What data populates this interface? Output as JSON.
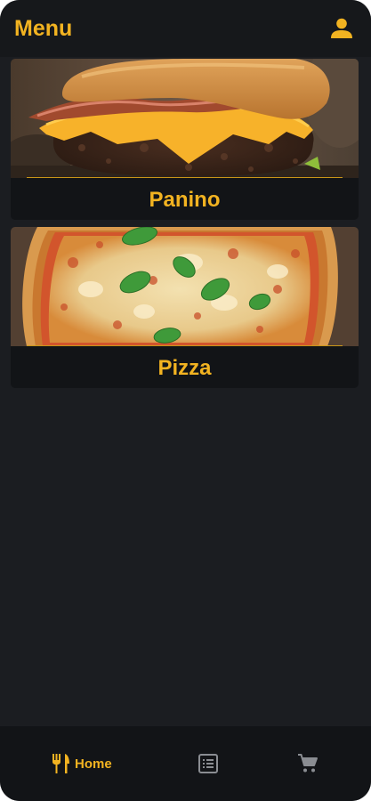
{
  "header": {
    "title": "Menu",
    "profile_icon": "person-icon"
  },
  "menu": {
    "items": [
      {
        "label": "Panino",
        "image": "burger-photo"
      },
      {
        "label": "Pizza",
        "image": "pizza-margherita-photo"
      }
    ]
  },
  "bottom_nav": {
    "items": [
      {
        "label": "Home",
        "icon": "fork-knife-icon",
        "active": true
      },
      {
        "label": "",
        "icon": "list-icon",
        "active": false
      },
      {
        "label": "",
        "icon": "cart-icon",
        "active": false
      }
    ]
  },
  "colors": {
    "accent": "#f2b321",
    "background": "#1b1d21",
    "header": "#16181b",
    "card": "#121417",
    "inactive_icon": "#8a8d92"
  }
}
